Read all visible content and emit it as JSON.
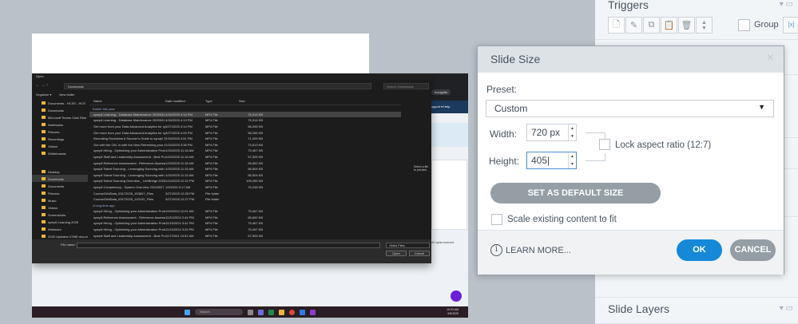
{
  "embedded": {
    "dialog_title": "Open",
    "address": "Downloads",
    "search_placeholder": "Search Downloads",
    "organize": "Organize ▾",
    "new_folder": "New folder",
    "incognito": "Incognito",
    "nav_items": [
      "Documents - HCSS - HCS",
      "Downloads",
      "Microsoft Teams Chat Files",
      "Notebooks",
      "Pictures",
      "Recordings",
      "Videos",
      "Whiteboards",
      "Desktop",
      "Downloads",
      "Documents",
      "Pictures",
      "Music",
      "Videos",
      "Screenshots",
      "sympli Learning 2025",
      "Webinars",
      "2025 Updated UTMD documents"
    ],
    "columns": [
      "Name",
      "Date modified",
      "Type",
      "Size"
    ],
    "group1": "Earlier this year",
    "group2": "A long time ago",
    "rows1": [
      [
        "sympli Learning - Database Maintenance 2025041 16...",
        "4/16/2025 4:14 PM",
        "MP4 File",
        "75,314 KB"
      ],
      [
        "sympli Learning - Database Maintenance 2025041 16...",
        "4/16/2025 4:13 PM",
        "MP4 File",
        "75,314 KB"
      ],
      [
        "Get more from your Data Advanced Analytics for sym...",
        "3/27/2025 4:14 PM",
        "MP4 File",
        "56,255 KB"
      ],
      [
        "Get more from your Data Advanced Analytics for sym...",
        "3/27/2025 4:05 PM",
        "MP4 File",
        "56,255 KB"
      ],
      [
        "Recruiting Rockstars A Sourcer's Guide to sympli Tale...",
        "2/18/2025 4:51 PM",
        "MP4 File",
        "71,009 KB"
      ],
      [
        "Out with the Old, in with the New Refreshing your ATS...",
        "1/15/2025 3:36 PM",
        "MP4 File",
        "74,613 KB"
      ],
      [
        "sympli Hiring - Optimizing your Administrative Proble...",
        "1/15/2025 11:18 AM",
        "MP4 File",
        "75,467 KB"
      ],
      [
        "sympli Staff and Leadership Assessment - Best Practic...",
        "1/15/2025 11:18 AM",
        "MP4 File",
        "57,505 KB"
      ],
      [
        "sympli Reference Assessment - Reference Assessment...",
        "1/15/2025 11:18 AM",
        "MP4 File",
        "65,652 KB"
      ],
      [
        "sympli Talent Sourcing - Leveraging Sourcing with yo...",
        "1/15/2025 11:15 AM",
        "MP4 File",
        "56,504 KB"
      ],
      [
        "sympli Talent Sourcing - Leveraging Sourcing with yo...",
        "1/15/2025 11:15 AM",
        "MP4 File",
        "56,504 KB"
      ],
      [
        "sympli Talent Sourcing Overview _ LifeBridge 2025011...",
        "1/14/2025 12:21 PM",
        "MP4 File",
        "105,265 KB"
      ],
      [
        "sympli Competency - System Overview 20240927 155...",
        "1/9/2025 9:17 AM",
        "MP4 File",
        "76,248 KB"
      ],
      [
        "CourseGridData_03172025_153847_Files",
        "3/27/2025 12:28 PM",
        "File folder",
        ""
      ],
      [
        "CourseGridData_03172025_143132_Files",
        "3/27/2025 12:27 PM",
        "File folder",
        ""
      ]
    ],
    "rows2": [
      [
        "sympli Hiring - Optimizing your Administration Proble...",
        "12/9/2024 11:01 AM",
        "MP4 File",
        "75,467 KB"
      ],
      [
        "sympli Reference Assessment - Reference Assessment...",
        "11/20/2024 2:44 PM",
        "MP4 File",
        "65,652 KB"
      ],
      [
        "sympli Hiring - Optimizing your Administration Proble...",
        "11/15/2024 3:42 PM",
        "MP4 File",
        "75,467 KB"
      ],
      [
        "sympli Hiring - Optimizing your Administration Proble...",
        "11/15/2024 3:29 PM",
        "MP4 File",
        "75,467 KB"
      ],
      [
        "sympli Staff and Leadership Assessment - Best Practic...",
        "11/7/2024 10:51 AM",
        "MP4 File",
        "57,505 KB"
      ]
    ],
    "preview_text": "Select a file to preview.",
    "file_name_label": "File name:",
    "file_type": "Video Files",
    "open": "Open",
    "cancel": "Cancel",
    "support": "Support ▾",
    "help": "Help",
    "rights": "All rights reserved.",
    "taskbar_search": "Search",
    "clock_time": "10:03 AM",
    "clock_date": "6/5/2025"
  },
  "panel": {
    "triggers_title": "Triggers",
    "group_label": "Group",
    "slide_layers_title": "Slide Layers"
  },
  "dialog": {
    "title": "Slide Size",
    "preset_label": "Preset:",
    "preset_value": "Custom",
    "width_label": "Width:",
    "width_value": "720 px",
    "height_label": "Height:",
    "height_value": "405",
    "lock_label": "Lock aspect ratio (12:7)",
    "set_default": "SET AS DEFAULT SIZE",
    "scale_label": "Scale existing content to fit",
    "learn_more": "LEARN MORE...",
    "ok": "OK",
    "cancel": "CANCEL"
  }
}
